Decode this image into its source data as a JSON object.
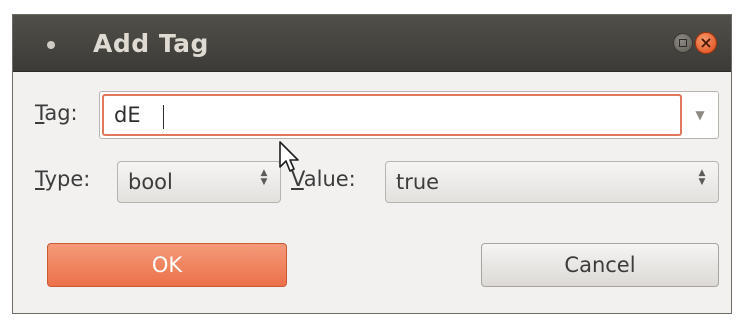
{
  "window": {
    "title": "Add Tag"
  },
  "form": {
    "tag": {
      "label_mnemonic": "T",
      "label_rest": "ag:",
      "value": "dE"
    },
    "type": {
      "label_mnemonic": "T",
      "label_rest": "ype:",
      "selected": "bool"
    },
    "value": {
      "label_mnemonic": "V",
      "label_rest": "alue:",
      "selected": "true"
    }
  },
  "buttons": {
    "ok_label": "OK",
    "cancel_label": "Cancel"
  },
  "colors": {
    "accent": "#e2785a",
    "ok_button": "#ec7148",
    "titlebar": "#3d3b37"
  },
  "icons": {
    "close": "close-icon",
    "maximize": "maximize-icon",
    "menu": "window-menu-icon",
    "dropdown": "chevron-down-icon",
    "spin": "spin-arrows-icon",
    "pointer": "mouse-pointer-icon"
  }
}
